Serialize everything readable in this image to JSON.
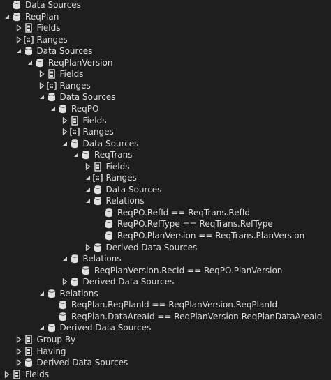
{
  "tree": [
    {
      "label": "Data Sources",
      "icon": "datasource-icon",
      "arrow": "none",
      "depth": 0
    },
    {
      "label": "ReqPlan",
      "icon": "datasource-icon",
      "arrow": "expanded",
      "depth": 0
    },
    {
      "label": "Fields",
      "icon": "fields-icon",
      "arrow": "collapsed",
      "depth": 1
    },
    {
      "label": "Ranges",
      "icon": "ranges-icon",
      "arrow": "collapsed",
      "depth": 1
    },
    {
      "label": "Data Sources",
      "icon": "datasource-icon",
      "arrow": "expanded",
      "depth": 1
    },
    {
      "label": "ReqPlanVersion",
      "icon": "datasource-icon",
      "arrow": "expanded",
      "depth": 2
    },
    {
      "label": "Fields",
      "icon": "fields-icon",
      "arrow": "collapsed",
      "depth": 3
    },
    {
      "label": "Ranges",
      "icon": "ranges-icon",
      "arrow": "collapsed",
      "depth": 3
    },
    {
      "label": "Data Sources",
      "icon": "datasource-icon",
      "arrow": "expanded",
      "depth": 3
    },
    {
      "label": "ReqPO",
      "icon": "datasource-icon",
      "arrow": "expanded",
      "depth": 4
    },
    {
      "label": "Fields",
      "icon": "fields-icon",
      "arrow": "collapsed",
      "depth": 5
    },
    {
      "label": "Ranges",
      "icon": "ranges-icon",
      "arrow": "collapsed",
      "depth": 5
    },
    {
      "label": "Data Sources",
      "icon": "datasource-icon",
      "arrow": "expanded",
      "depth": 5
    },
    {
      "label": "ReqTrans",
      "icon": "datasource-icon",
      "arrow": "expanded",
      "depth": 6
    },
    {
      "label": "Fields",
      "icon": "fields-icon",
      "arrow": "collapsed",
      "depth": 7
    },
    {
      "label": "Ranges",
      "icon": "ranges-icon",
      "arrow": "expanded",
      "depth": 7
    },
    {
      "label": "Data Sources",
      "icon": "datasource-icon",
      "arrow": "expanded",
      "depth": 7
    },
    {
      "label": "Relations",
      "icon": "datasource-icon",
      "arrow": "expanded",
      "depth": 7
    },
    {
      "label": "ReqPO.RefId == ReqTrans.RefId",
      "icon": "datasource-icon",
      "arrow": "none",
      "depth": 8
    },
    {
      "label": "ReqPO.RefType == ReqTrans.RefType",
      "icon": "datasource-icon",
      "arrow": "none",
      "depth": 8
    },
    {
      "label": "ReqPO.PlanVersion == ReqTrans.PlanVersion",
      "icon": "datasource-icon",
      "arrow": "none",
      "depth": 8
    },
    {
      "label": "Derived Data Sources",
      "icon": "datasource-icon",
      "arrow": "collapsed",
      "depth": 7
    },
    {
      "label": "Relations",
      "icon": "datasource-icon",
      "arrow": "expanded",
      "depth": 5
    },
    {
      "label": "ReqPlanVersion.RecId == ReqPO.PlanVersion",
      "icon": "datasource-icon",
      "arrow": "none",
      "depth": 6
    },
    {
      "label": "Derived Data Sources",
      "icon": "datasource-icon",
      "arrow": "collapsed",
      "depth": 5
    },
    {
      "label": "Relations",
      "icon": "datasource-icon",
      "arrow": "expanded",
      "depth": 3
    },
    {
      "label": "ReqPlan.ReqPlanId == ReqPlanVersion.ReqPlanId",
      "icon": "datasource-icon",
      "arrow": "none",
      "depth": 4
    },
    {
      "label": "ReqPlan.DataAreaId == ReqPlanVersion.ReqPlanDataAreaId",
      "icon": "datasource-icon",
      "arrow": "none",
      "depth": 4
    },
    {
      "label": "Derived Data Sources",
      "icon": "datasource-icon",
      "arrow": "expanded",
      "depth": 3
    },
    {
      "label": "Group By",
      "icon": "fields-icon",
      "arrow": "collapsed",
      "depth": 1
    },
    {
      "label": "Having",
      "icon": "fields-icon",
      "arrow": "collapsed",
      "depth": 1
    },
    {
      "label": "Derived Data Sources",
      "icon": "datasource-icon",
      "arrow": "collapsed",
      "depth": 1
    },
    {
      "label": "Fields",
      "icon": "fields-icon",
      "arrow": "collapsed",
      "depth": 0
    }
  ]
}
